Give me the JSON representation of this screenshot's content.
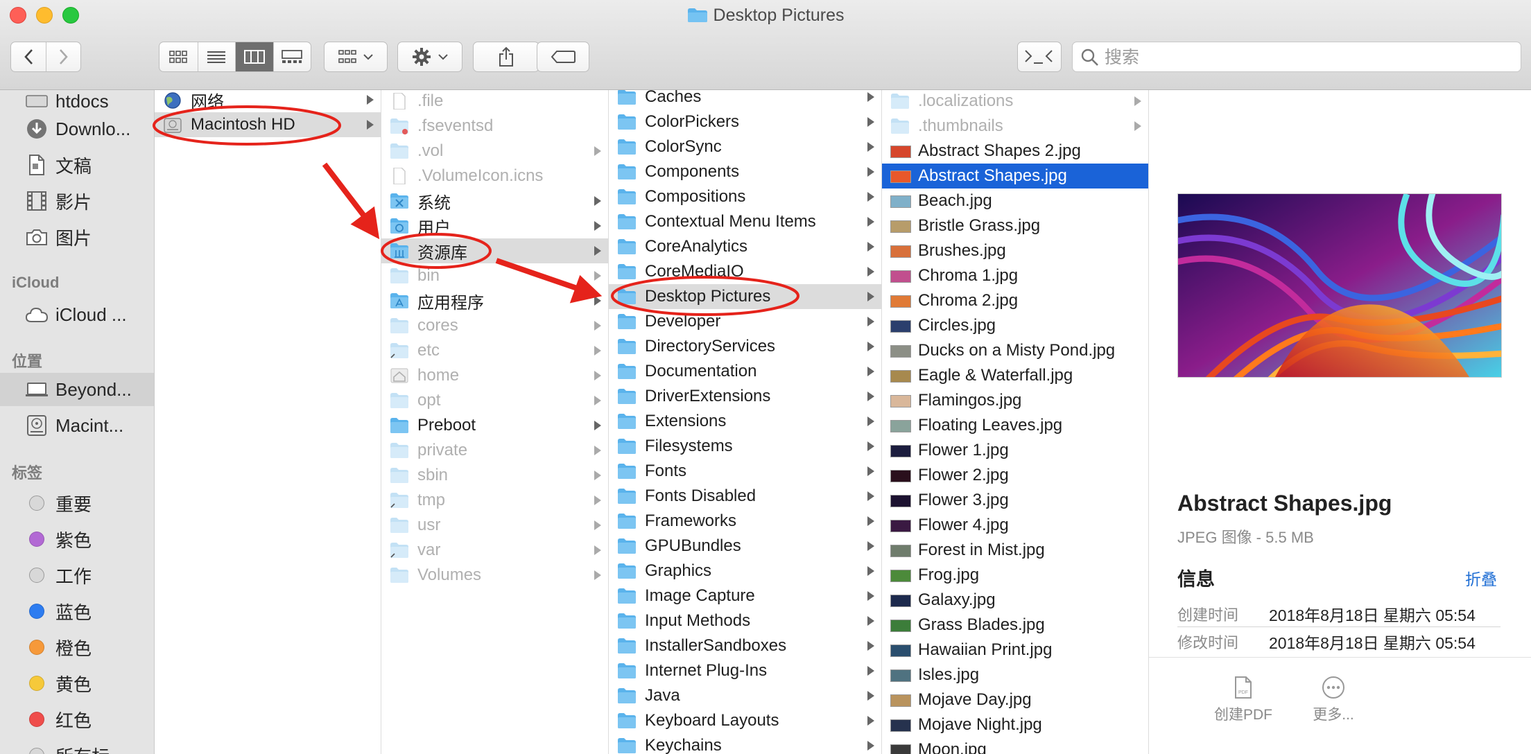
{
  "window": {
    "title": "Desktop Pictures"
  },
  "search": {
    "placeholder": "搜索"
  },
  "sidebar": {
    "items_top": [
      {
        "label": "htdocs",
        "icon": "drive-icon"
      },
      {
        "label": "Downlo...",
        "icon": "download-icon"
      },
      {
        "label": "文稿",
        "icon": "document-icon"
      },
      {
        "label": "影片",
        "icon": "film-icon"
      },
      {
        "label": "图片",
        "icon": "camera-icon"
      }
    ],
    "icloud_header": "iCloud",
    "icloud_items": [
      {
        "label": "iCloud ...",
        "icon": "cloud-icon"
      }
    ],
    "locations_header": "位置",
    "locations": [
      {
        "label": "Beyond...",
        "icon": "laptop-icon",
        "selected": true
      },
      {
        "label": "Macint...",
        "icon": "disk-icon"
      }
    ],
    "tags_header": "标签",
    "tags": [
      {
        "label": "重要",
        "color": "#d8d8d8"
      },
      {
        "label": "紫色",
        "color": "#b269d4"
      },
      {
        "label": "工作",
        "color": "#d8d8d8"
      },
      {
        "label": "蓝色",
        "color": "#2d7cf0"
      },
      {
        "label": "橙色",
        "color": "#f6993a"
      },
      {
        "label": "黄色",
        "color": "#f6c93a"
      },
      {
        "label": "红色",
        "color": "#ef4d4b"
      },
      {
        "label": "所有标",
        "color": "#d8d8d8"
      }
    ]
  },
  "column1": [
    {
      "name": "网络",
      "icon": "globe",
      "chevron": true
    },
    {
      "name": "Macintosh HD",
      "icon": "disk",
      "chevron": true,
      "highlight": true
    }
  ],
  "column2": [
    {
      "name": ".file",
      "icon": "file",
      "dim": true
    },
    {
      "name": ".fseventsd",
      "icon": "folder-locked",
      "dim": true
    },
    {
      "name": ".vol",
      "icon": "folder",
      "dim": true,
      "chevron": true
    },
    {
      "name": ".VolumeIcon.icns",
      "icon": "file",
      "dim": true
    },
    {
      "name": "系统",
      "icon": "folder-system",
      "chevron": true
    },
    {
      "name": "用户",
      "icon": "folder-users",
      "chevron": true
    },
    {
      "name": "资源库",
      "icon": "folder-library",
      "chevron": true,
      "highlight": true
    },
    {
      "name": "bin",
      "icon": "folder",
      "dim": true,
      "chevron": true
    },
    {
      "name": "应用程序",
      "icon": "folder-apps",
      "chevron": true
    },
    {
      "name": "cores",
      "icon": "folder",
      "dim": true,
      "chevron": true
    },
    {
      "name": "etc",
      "icon": "folder-alias",
      "dim": true,
      "chevron": true
    },
    {
      "name": "home",
      "icon": "home",
      "dim": true,
      "chevron": true
    },
    {
      "name": "opt",
      "icon": "folder",
      "dim": true,
      "chevron": true
    },
    {
      "name": "Preboot",
      "icon": "folder",
      "chevron": true
    },
    {
      "name": "private",
      "icon": "folder",
      "dim": true,
      "chevron": true
    },
    {
      "name": "sbin",
      "icon": "folder",
      "dim": true,
      "chevron": true
    },
    {
      "name": "tmp",
      "icon": "folder-alias",
      "dim": true,
      "chevron": true
    },
    {
      "name": "usr",
      "icon": "folder",
      "dim": true,
      "chevron": true
    },
    {
      "name": "var",
      "icon": "folder-alias",
      "dim": true,
      "chevron": true
    },
    {
      "name": "Volumes",
      "icon": "folder",
      "dim": true,
      "chevron": true
    }
  ],
  "column3": [
    {
      "name": "Caches",
      "chevron": true
    },
    {
      "name": "ColorPickers",
      "chevron": true
    },
    {
      "name": "ColorSync",
      "chevron": true
    },
    {
      "name": "Components",
      "chevron": true
    },
    {
      "name": "Compositions",
      "chevron": true
    },
    {
      "name": "Contextual Menu Items",
      "chevron": true
    },
    {
      "name": "CoreAnalytics",
      "chevron": true
    },
    {
      "name": "CoreMediaIO",
      "chevron": true
    },
    {
      "name": "Desktop Pictures",
      "chevron": true,
      "highlight": true
    },
    {
      "name": "Developer",
      "chevron": true
    },
    {
      "name": "DirectoryServices",
      "chevron": true
    },
    {
      "name": "Documentation",
      "chevron": true
    },
    {
      "name": "DriverExtensions",
      "chevron": true
    },
    {
      "name": "Extensions",
      "chevron": true
    },
    {
      "name": "Filesystems",
      "chevron": true
    },
    {
      "name": "Fonts",
      "chevron": true
    },
    {
      "name": "Fonts Disabled",
      "chevron": true
    },
    {
      "name": "Frameworks",
      "chevron": true
    },
    {
      "name": "GPUBundles",
      "chevron": true
    },
    {
      "name": "Graphics",
      "chevron": true
    },
    {
      "name": "Image Capture",
      "chevron": true
    },
    {
      "name": "Input Methods",
      "chevron": true
    },
    {
      "name": "InstallerSandboxes",
      "chevron": true
    },
    {
      "name": "Internet Plug-Ins",
      "chevron": true
    },
    {
      "name": "Java",
      "chevron": true
    },
    {
      "name": "Keyboard Layouts",
      "chevron": true
    },
    {
      "name": "Keychains",
      "chevron": true
    }
  ],
  "column4": [
    {
      "name": ".localizations",
      "kind": "folder",
      "dim": true,
      "chevron": true
    },
    {
      "name": ".thumbnails",
      "kind": "folder",
      "dim": true,
      "chevron": true
    },
    {
      "name": "Abstract Shapes 2.jpg",
      "kind": "image",
      "thumb": "#d6472c"
    },
    {
      "name": "Abstract Shapes.jpg",
      "kind": "image",
      "thumb": "#e8582a",
      "selected": true
    },
    {
      "name": "Beach.jpg",
      "kind": "image",
      "thumb": "#7fb0c9"
    },
    {
      "name": "Bristle Grass.jpg",
      "kind": "image",
      "thumb": "#b79c6a"
    },
    {
      "name": "Brushes.jpg",
      "kind": "image",
      "thumb": "#d8703a"
    },
    {
      "name": "Chroma 1.jpg",
      "kind": "image",
      "thumb": "#c14f8e"
    },
    {
      "name": "Chroma 2.jpg",
      "kind": "image",
      "thumb": "#e07a36"
    },
    {
      "name": "Circles.jpg",
      "kind": "image",
      "thumb": "#2b3f6d"
    },
    {
      "name": "Ducks on a Misty Pond.jpg",
      "kind": "image",
      "thumb": "#8c8f86"
    },
    {
      "name": "Eagle & Waterfall.jpg",
      "kind": "image",
      "thumb": "#a7894e"
    },
    {
      "name": "Flamingos.jpg",
      "kind": "image",
      "thumb": "#d9b79a"
    },
    {
      "name": "Floating Leaves.jpg",
      "kind": "image",
      "thumb": "#8aa39b"
    },
    {
      "name": "Flower 1.jpg",
      "kind": "image",
      "thumb": "#1c1d3e"
    },
    {
      "name": "Flower 2.jpg",
      "kind": "image",
      "thumb": "#2a0f1c"
    },
    {
      "name": "Flower 3.jpg",
      "kind": "image",
      "thumb": "#1c1230"
    },
    {
      "name": "Flower 4.jpg",
      "kind": "image",
      "thumb": "#3a1942"
    },
    {
      "name": "Forest in Mist.jpg",
      "kind": "image",
      "thumb": "#6f7c6c"
    },
    {
      "name": "Frog.jpg",
      "kind": "image",
      "thumb": "#4c8a3a"
    },
    {
      "name": "Galaxy.jpg",
      "kind": "image",
      "thumb": "#1d2a4d"
    },
    {
      "name": "Grass Blades.jpg",
      "kind": "image",
      "thumb": "#3c7d3a"
    },
    {
      "name": "Hawaiian Print.jpg",
      "kind": "image",
      "thumb": "#2a4e6e"
    },
    {
      "name": "Isles.jpg",
      "kind": "image",
      "thumb": "#4f7280"
    },
    {
      "name": "Mojave Day.jpg",
      "kind": "image",
      "thumb": "#b9935d"
    },
    {
      "name": "Mojave Night.jpg",
      "kind": "image",
      "thumb": "#26324e"
    },
    {
      "name": "Moon.jpg",
      "kind": "image",
      "thumb": "#3a3a3a"
    }
  ],
  "preview": {
    "name": "Abstract Shapes.jpg",
    "kind": "JPEG 图像 - 5.5 MB",
    "info_label": "信息",
    "collapse_label": "折叠",
    "created_label": "创建时间",
    "created_value": "2018年8月18日 星期六 05:54",
    "modified_label": "修改时间",
    "modified_value": "2018年8月18日 星期六 05:54",
    "action_pdf": "创建PDF",
    "action_more": "更多..."
  },
  "colors": {
    "selection": "#1a63d8",
    "folder": "#5ab3ec",
    "annotation": "#e5231b"
  }
}
